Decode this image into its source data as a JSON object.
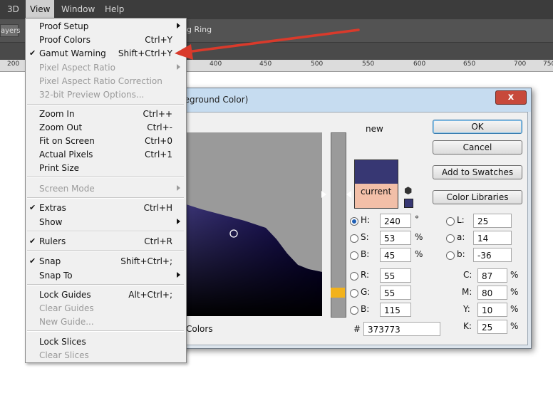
{
  "menubar": {
    "items": [
      "3D",
      "View",
      "Window",
      "Help"
    ]
  },
  "options_bar": {
    "tab_fragment": "ayers",
    "ring_label": "g Ring"
  },
  "ruler": {
    "labels": [
      "200",
      "400",
      "450",
      "500",
      "550",
      "600",
      "650",
      "700",
      "750"
    ]
  },
  "view_menu": {
    "items": [
      {
        "label": "Proof Setup",
        "shortcut": "",
        "submenu": true,
        "checked": false,
        "disabled": false
      },
      {
        "label": "Proof Colors",
        "shortcut": "Ctrl+Y",
        "submenu": false,
        "checked": false,
        "disabled": false
      },
      {
        "label": "Gamut Warning",
        "shortcut": "Shift+Ctrl+Y",
        "submenu": false,
        "checked": true,
        "disabled": false
      },
      {
        "label": "Pixel Aspect Ratio",
        "shortcut": "",
        "submenu": true,
        "checked": false,
        "disabled": true
      },
      {
        "label": "Pixel Aspect Ratio Correction",
        "shortcut": "",
        "submenu": false,
        "checked": false,
        "disabled": true
      },
      {
        "label": "32-bit Preview Options...",
        "shortcut": "",
        "submenu": false,
        "checked": false,
        "disabled": true
      },
      {
        "label": "Zoom In",
        "shortcut": "Ctrl++",
        "submenu": false,
        "checked": false,
        "disabled": false
      },
      {
        "label": "Zoom Out",
        "shortcut": "Ctrl+-",
        "submenu": false,
        "checked": false,
        "disabled": false
      },
      {
        "label": "Fit on Screen",
        "shortcut": "Ctrl+0",
        "submenu": false,
        "checked": false,
        "disabled": false
      },
      {
        "label": "Actual Pixels",
        "shortcut": "Ctrl+1",
        "submenu": false,
        "checked": false,
        "disabled": false
      },
      {
        "label": "Print Size",
        "shortcut": "",
        "submenu": false,
        "checked": false,
        "disabled": false
      },
      {
        "label": "Screen Mode",
        "shortcut": "",
        "submenu": true,
        "checked": false,
        "disabled": true
      },
      {
        "label": "Extras",
        "shortcut": "Ctrl+H",
        "submenu": false,
        "checked": true,
        "disabled": false
      },
      {
        "label": "Show",
        "shortcut": "",
        "submenu": true,
        "checked": false,
        "disabled": false
      },
      {
        "label": "Rulers",
        "shortcut": "Ctrl+R",
        "submenu": false,
        "checked": true,
        "disabled": false
      },
      {
        "label": "Snap",
        "shortcut": "Shift+Ctrl+;",
        "submenu": false,
        "checked": true,
        "disabled": false
      },
      {
        "label": "Snap To",
        "shortcut": "",
        "submenu": true,
        "checked": false,
        "disabled": false
      },
      {
        "label": "Lock Guides",
        "shortcut": "Alt+Ctrl+;",
        "submenu": false,
        "checked": false,
        "disabled": false
      },
      {
        "label": "Clear Guides",
        "shortcut": "",
        "submenu": false,
        "checked": false,
        "disabled": true
      },
      {
        "label": "New Guide...",
        "shortcut": "",
        "submenu": false,
        "checked": false,
        "disabled": true
      },
      {
        "label": "Lock Slices",
        "shortcut": "",
        "submenu": false,
        "checked": false,
        "disabled": false
      },
      {
        "label": "Clear Slices",
        "shortcut": "",
        "submenu": false,
        "checked": false,
        "disabled": true
      }
    ]
  },
  "color_picker": {
    "title": "reground Color)",
    "close_label": "x",
    "new_label": "new",
    "current_label": "current",
    "new_color": "#373773",
    "current_color": "#f2bfa8",
    "buttons": {
      "ok": "OK",
      "cancel": "Cancel",
      "add_to_swatches": "Add to Swatches",
      "color_libraries": "Color Libraries"
    },
    "only_web_colors_fragment": "Colors",
    "hsb": {
      "h_label": "H:",
      "h_value": "240",
      "h_unit": "°",
      "s_label": "S:",
      "s_value": "53",
      "s_unit": "%",
      "b_label": "B:",
      "b_value": "45",
      "b_unit": "%"
    },
    "rgb": {
      "r_label": "R:",
      "r_value": "55",
      "g_label": "G:",
      "g_value": "55",
      "b_label": "B:",
      "b_value": "115"
    },
    "lab": {
      "l_label": "L:",
      "l_value": "25",
      "a_label": "a:",
      "a_value": "14",
      "b_label": "b:",
      "b_value": "-36"
    },
    "cmyk": {
      "c_label": "C:",
      "c_value": "87",
      "m_label": "M:",
      "m_value": "80",
      "y_label": "Y:",
      "y_value": "10",
      "k_label": "K:",
      "k_value": "25",
      "unit": "%"
    },
    "hex_label": "#",
    "hex_value": "373773",
    "selected_radio": "H"
  },
  "annotation": {
    "arrow_color": "#d93a2b"
  }
}
